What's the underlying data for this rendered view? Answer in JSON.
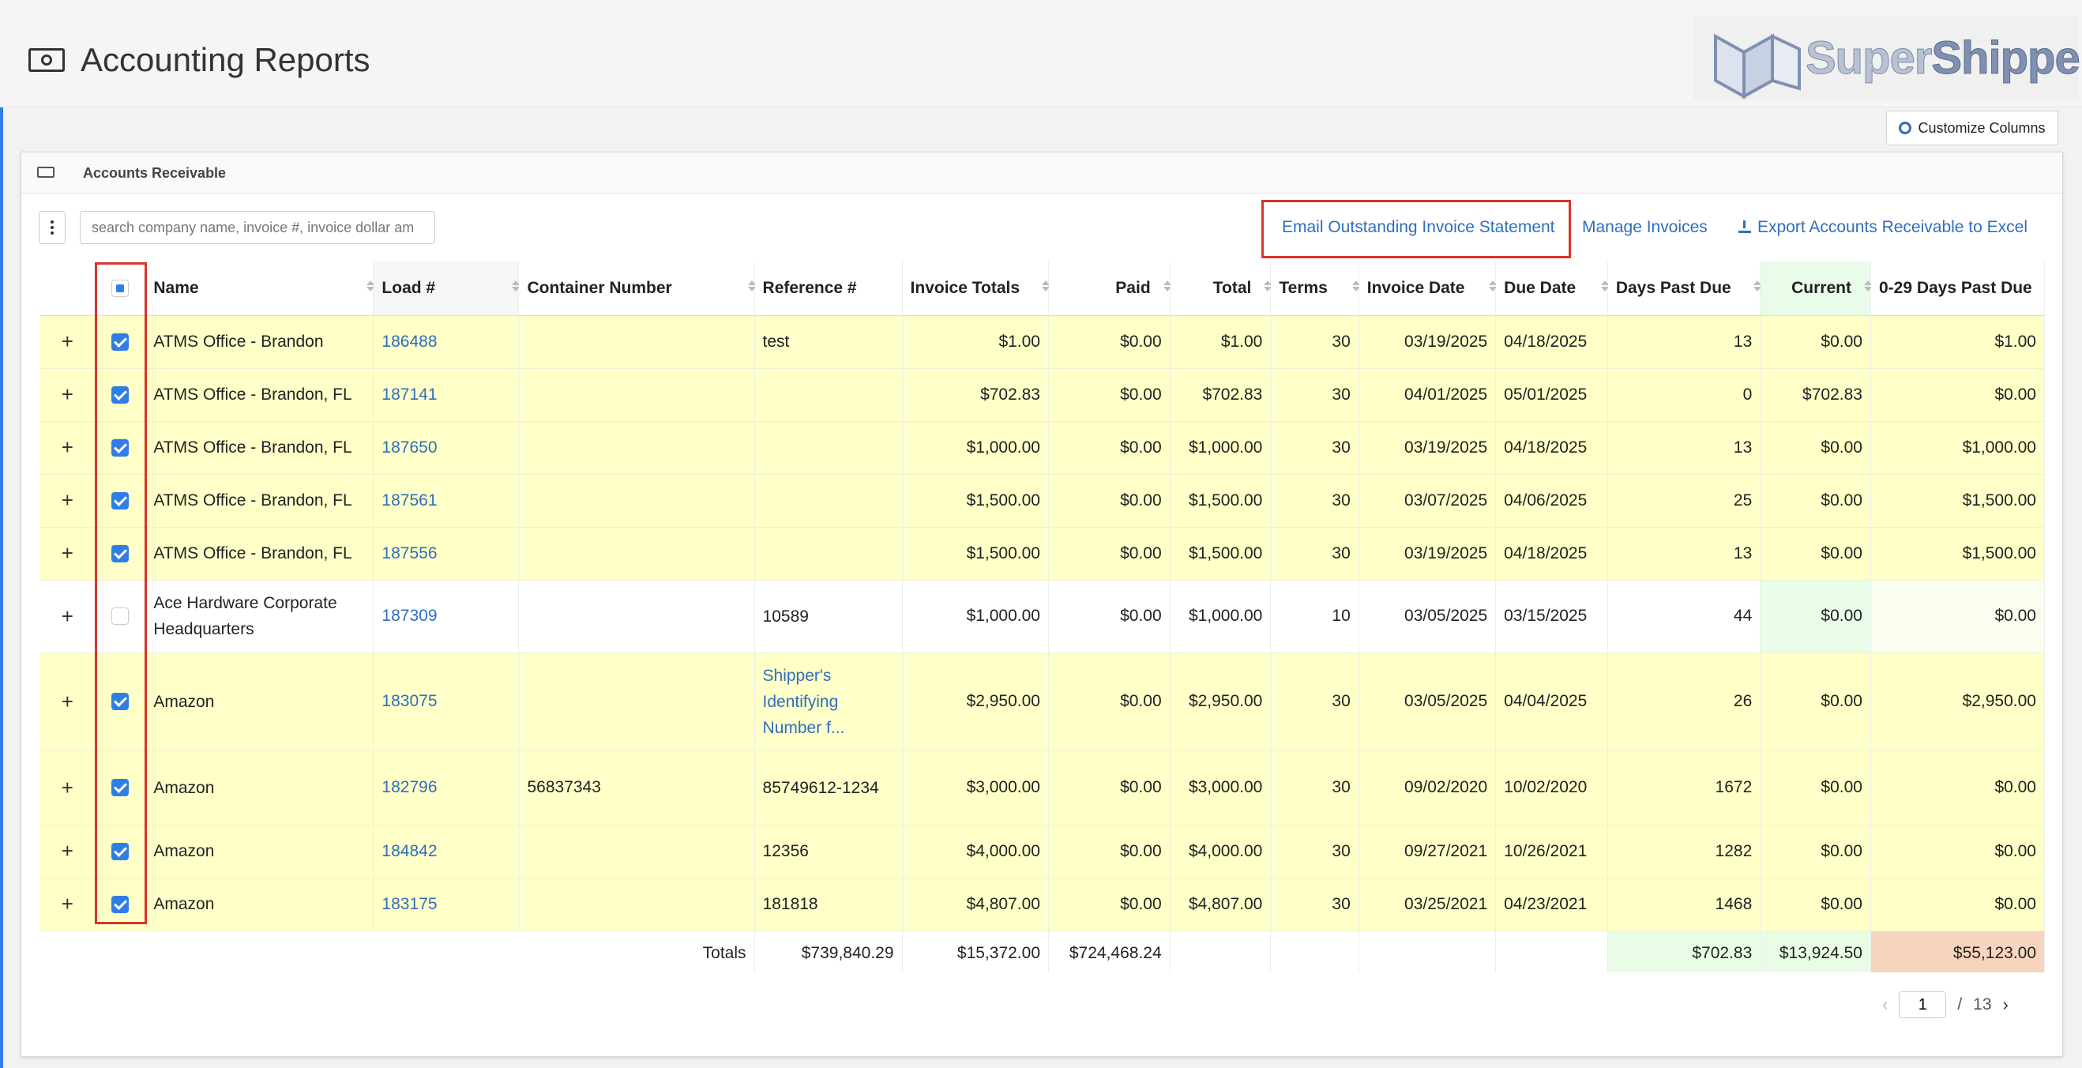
{
  "header": {
    "title": "Accounting Reports",
    "logo_super": "Super",
    "logo_shippers": "Shippers",
    "customize_label": "Customize Columns"
  },
  "card": {
    "title": "Accounts Receivable",
    "search_placeholder": "search company name, invoice #, invoice dollar am",
    "actions": {
      "email": "Email Outstanding Invoice Statement",
      "manage": "Manage Invoices",
      "export": "Export Accounts Receivable to Excel"
    }
  },
  "columns": [
    "Name",
    "Load #",
    "Container Number",
    "Reference #",
    "Invoice Totals",
    "Paid",
    "Total",
    "Terms",
    "Invoice Date",
    "Due Date",
    "Days Past Due",
    "Current",
    "0-29 Days Past Due"
  ],
  "rows": [
    {
      "checked": true,
      "name": "ATMS Office - Brandon",
      "load": "186488",
      "container": "",
      "ref": "test",
      "inv": "$1.00",
      "paid": "$0.00",
      "total": "$1.00",
      "terms": "30",
      "invdate": "03/19/2025",
      "due": "04/18/2025",
      "dpd": "13",
      "current": "$0.00",
      "age": "$1.00"
    },
    {
      "checked": true,
      "name": "ATMS Office - Brandon, FL",
      "load": "187141",
      "container": "",
      "ref": "",
      "inv": "$702.83",
      "paid": "$0.00",
      "total": "$702.83",
      "terms": "30",
      "invdate": "04/01/2025",
      "due": "05/01/2025",
      "dpd": "0",
      "current": "$702.83",
      "age": "$0.00"
    },
    {
      "checked": true,
      "name": "ATMS Office - Brandon, FL",
      "load": "187650",
      "container": "",
      "ref": "",
      "inv": "$1,000.00",
      "paid": "$0.00",
      "total": "$1,000.00",
      "terms": "30",
      "invdate": "03/19/2025",
      "due": "04/18/2025",
      "dpd": "13",
      "current": "$0.00",
      "age": "$1,000.00"
    },
    {
      "checked": true,
      "name": "ATMS Office - Brandon, FL",
      "load": "187561",
      "container": "",
      "ref": "",
      "inv": "$1,500.00",
      "paid": "$0.00",
      "total": "$1,500.00",
      "terms": "30",
      "invdate": "03/07/2025",
      "due": "04/06/2025",
      "dpd": "25",
      "current": "$0.00",
      "age": "$1,500.00"
    },
    {
      "checked": true,
      "name": "ATMS Office - Brandon, FL",
      "load": "187556",
      "container": "",
      "ref": "",
      "inv": "$1,500.00",
      "paid": "$0.00",
      "total": "$1,500.00",
      "terms": "30",
      "invdate": "03/19/2025",
      "due": "04/18/2025",
      "dpd": "13",
      "current": "$0.00",
      "age": "$1,500.00"
    },
    {
      "checked": false,
      "name": "Ace Hardware Corporate Headquarters",
      "load": "187309",
      "container": "",
      "ref": "10589",
      "inv": "$1,000.00",
      "paid": "$0.00",
      "total": "$1,000.00",
      "terms": "10",
      "invdate": "03/05/2025",
      "due": "03/15/2025",
      "dpd": "44",
      "current": "$0.00",
      "age": "$0.00"
    },
    {
      "checked": true,
      "name": "Amazon",
      "load": "183075",
      "container": "",
      "ref": "Shipper's Identifying Number f...",
      "inv": "$2,950.00",
      "paid": "$0.00",
      "total": "$2,950.00",
      "terms": "30",
      "invdate": "03/05/2025",
      "due": "04/04/2025",
      "dpd": "26",
      "current": "$0.00",
      "age": "$2,950.00"
    },
    {
      "checked": true,
      "name": "Amazon",
      "load": "182796",
      "container": "56837343",
      "ref": "85749612-1234",
      "inv": "$3,000.00",
      "paid": "$0.00",
      "total": "$3,000.00",
      "terms": "30",
      "invdate": "09/02/2020",
      "due": "10/02/2020",
      "dpd": "1672",
      "current": "$0.00",
      "age": "$0.00"
    },
    {
      "checked": true,
      "name": "Amazon",
      "load": "184842",
      "container": "",
      "ref": "12356",
      "inv": "$4,000.00",
      "paid": "$0.00",
      "total": "$4,000.00",
      "terms": "30",
      "invdate": "09/27/2021",
      "due": "10/26/2021",
      "dpd": "1282",
      "current": "$0.00",
      "age": "$0.00"
    },
    {
      "checked": true,
      "name": "Amazon",
      "load": "183175",
      "container": "",
      "ref": "181818",
      "inv": "$4,807.00",
      "paid": "$0.00",
      "total": "$4,807.00",
      "terms": "30",
      "invdate": "03/25/2021",
      "due": "04/23/2021",
      "dpd": "1468",
      "current": "$0.00",
      "age": "$0.00"
    }
  ],
  "totals": {
    "label": "Totals",
    "inv": "$739,840.29",
    "paid": "$15,372.00",
    "total": "$724,468.24",
    "dpd": "$702.83",
    "current": "$13,924.50",
    "age": "$55,123.00"
  },
  "pager": {
    "page": "1",
    "sep": "/",
    "pages": "13"
  },
  "colors": {
    "row_highlight": "#ffffc8",
    "link": "#2f6ebd",
    "annotation": "#d9342b"
  }
}
